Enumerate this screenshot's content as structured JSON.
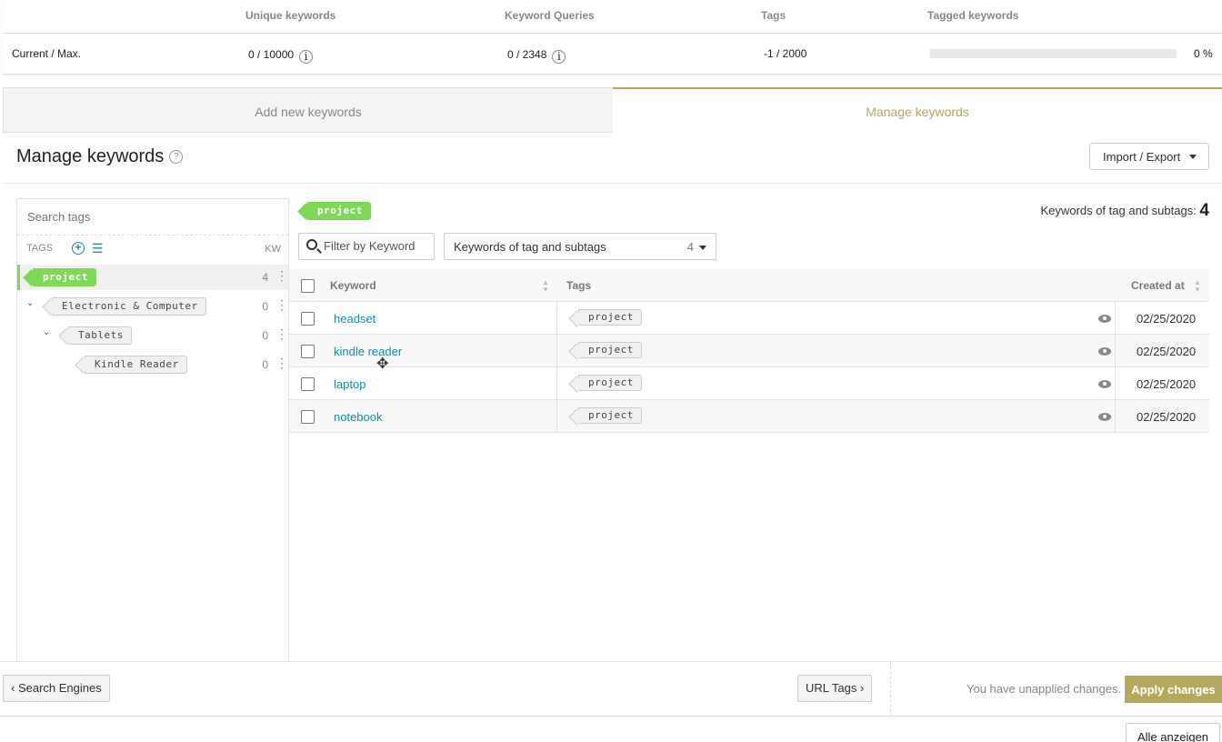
{
  "quota": {
    "headers": [
      "Unique keywords",
      "Keyword Queries",
      "Tags",
      "Tagged keywords"
    ],
    "row_label": "Current / Max.",
    "unique": "0 / 10000",
    "queries": "0 / 2348",
    "tags": "-1 / 2000",
    "tagged_pct": "0 %",
    "tagged_fraction": 0
  },
  "tabs": {
    "add": "Add new keywords",
    "manage": "Manage keywords"
  },
  "page": {
    "title": "Manage keywords",
    "help_icon": "?",
    "import_export": "Import / Export"
  },
  "sidebar": {
    "search_placeholder": "Search tags",
    "tags_label": "TAGS",
    "kw_label": "KW",
    "tree": [
      {
        "label": "project",
        "count": "4"
      },
      {
        "label": "Electronic & Computer",
        "count": "0"
      },
      {
        "label": "Tablets",
        "count": "0"
      },
      {
        "label": "Kindle Reader",
        "count": "0"
      }
    ]
  },
  "main": {
    "active_tag": "project",
    "kw_count_label": "Keywords of tag and subtags:",
    "kw_count": "4",
    "filter_placeholder": "Filter by Keyword",
    "scope_label": "Keywords of tag and subtags",
    "scope_count": "4",
    "columns": {
      "keyword": "Keyword",
      "tags": "Tags",
      "created": "Created at"
    },
    "rows": [
      {
        "keyword": "headset",
        "tag": "project",
        "date": "02/25/2020"
      },
      {
        "keyword": "kindle reader",
        "tag": "project",
        "date": "02/25/2020"
      },
      {
        "keyword": "laptop",
        "tag": "project",
        "date": "02/25/2020"
      },
      {
        "keyword": "notebook",
        "tag": "project",
        "date": "02/25/2020"
      }
    ]
  },
  "footer": {
    "back": "Search Engines",
    "next": "URL Tags",
    "unapplied": "You have unapplied changes.",
    "apply": "Apply changes",
    "show_all": "Alle anzeigen"
  },
  "colors": {
    "accent": "#b5a95e",
    "link": "#1a8ea8",
    "tag_green": "#7ed957"
  }
}
